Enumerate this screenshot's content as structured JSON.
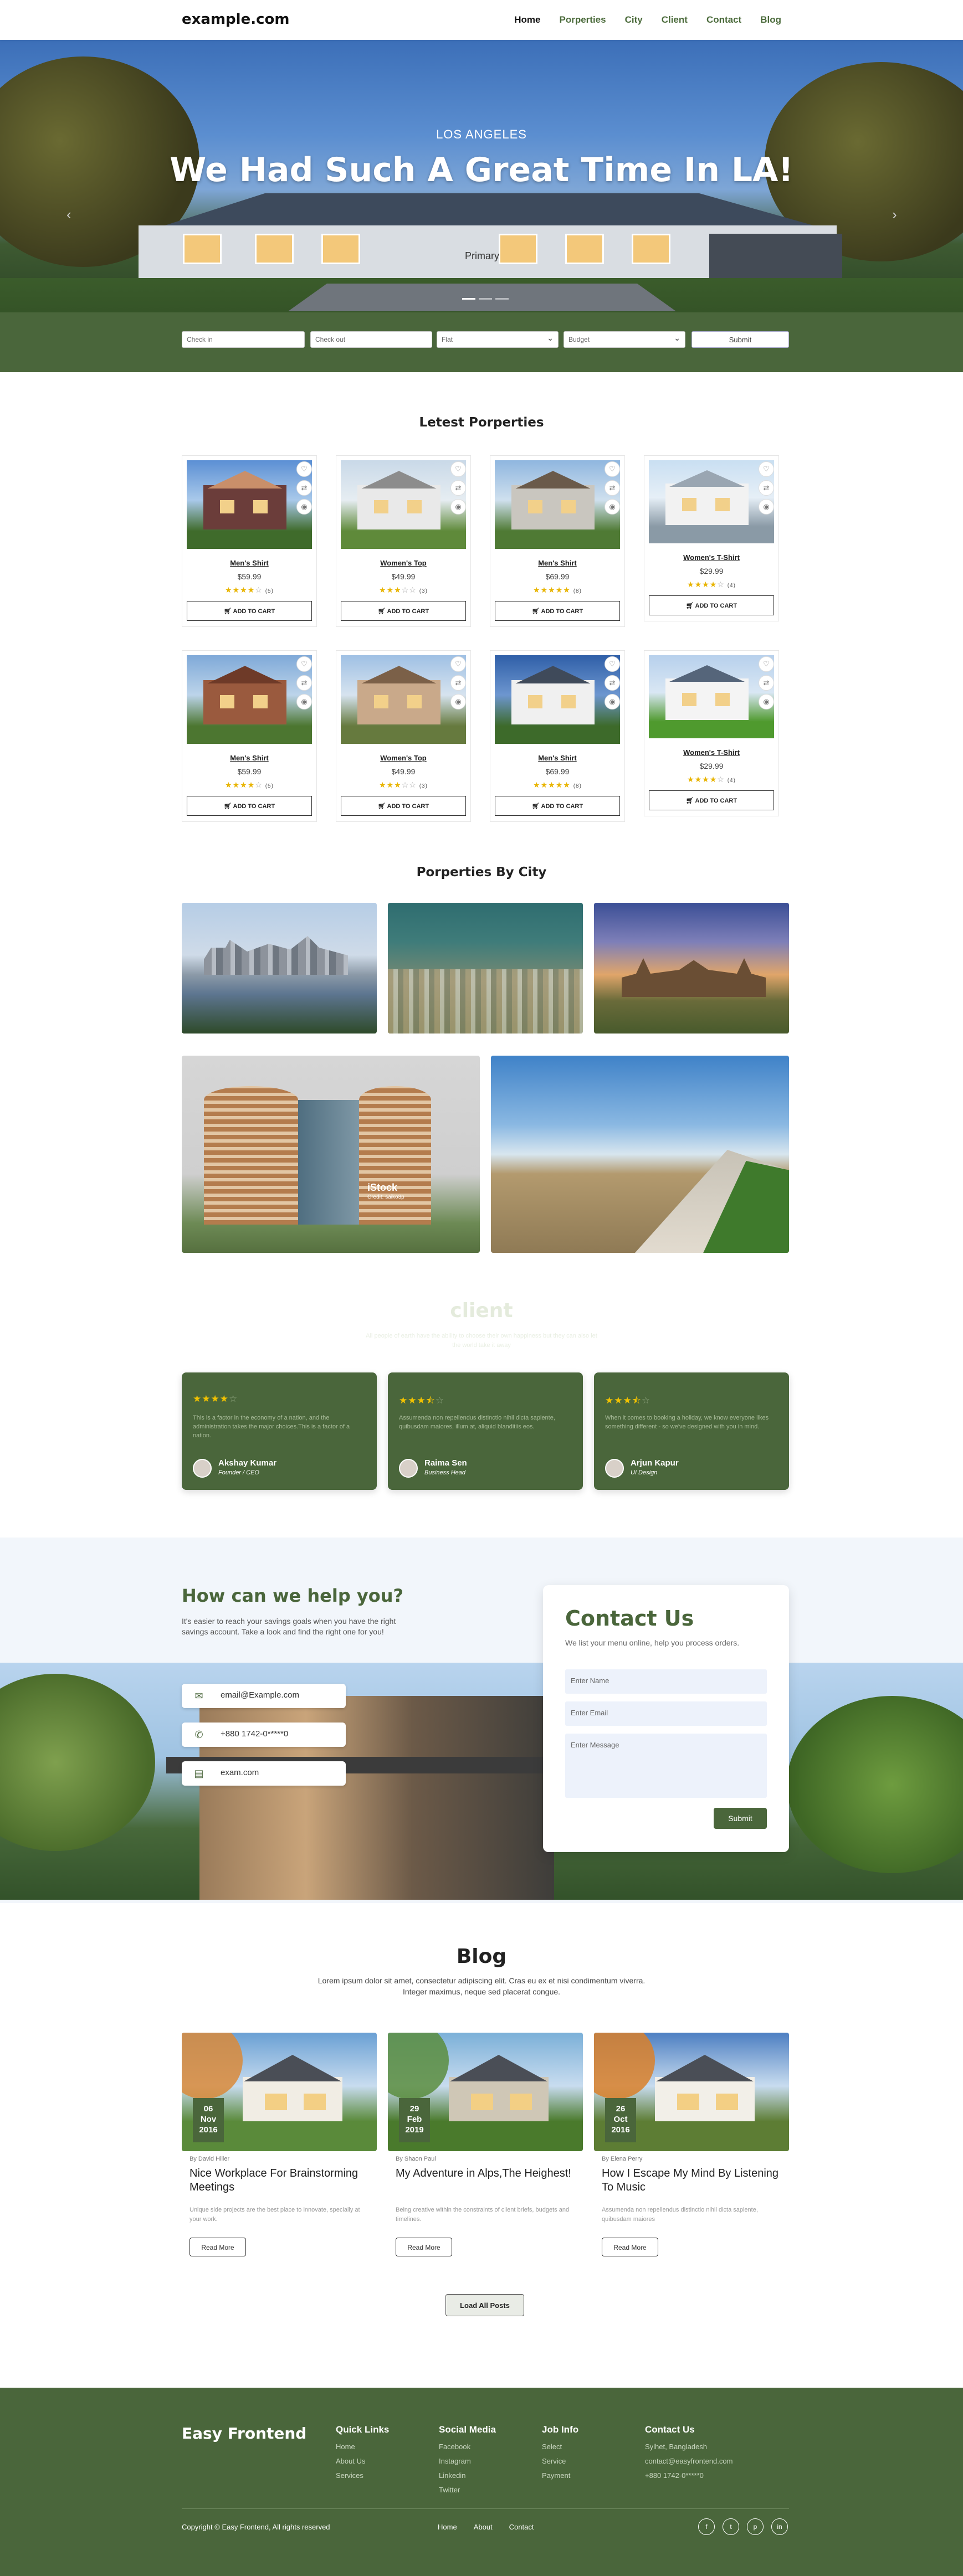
{
  "nav": {
    "brand": "example.com",
    "items": [
      "Home",
      "Porperties",
      "City",
      "Client",
      "Contact",
      "Blog"
    ]
  },
  "hero": {
    "location": "LOS ANGELES",
    "title": "We Had Such A Great Time In LA!",
    "button": "Primary"
  },
  "search": {
    "checkin_placeholder": "Check in",
    "checkout_placeholder": "Check out",
    "type_selected": "Flat",
    "budget_selected": "Budget",
    "submit": "Submit"
  },
  "latest": {
    "title": "Letest Porperties",
    "cart_label": "ADD TO CART",
    "items": [
      {
        "name": "Men's Shirt",
        "price": "$59.99",
        "rating": 4,
        "count": "(5)",
        "scene": "a"
      },
      {
        "name": "Women's Top",
        "price": "$49.99",
        "rating": 3,
        "count": "(3)",
        "scene": "b"
      },
      {
        "name": "Men's Shirt",
        "price": "$69.99",
        "rating": 5,
        "count": "(8)",
        "scene": "c"
      },
      {
        "name": "Women's T-Shirt",
        "price": "$29.99",
        "rating": 4,
        "count": "(4)",
        "scene": "d"
      },
      {
        "name": "Men's Shirt",
        "price": "$59.99",
        "rating": 4,
        "count": "(5)",
        "scene": "e"
      },
      {
        "name": "Women's Top",
        "price": "$49.99",
        "rating": 3,
        "count": "(3)",
        "scene": "f"
      },
      {
        "name": "Men's Shirt",
        "price": "$69.99",
        "rating": 5,
        "count": "(8)",
        "scene": "g"
      },
      {
        "name": "Women's T-Shirt",
        "price": "$29.99",
        "rating": 4,
        "count": "(4)",
        "scene": "h"
      }
    ]
  },
  "city": {
    "title": "Porperties By City",
    "watermark": "iStock",
    "watermark_sub": "Credit: saiko3p"
  },
  "client": {
    "title": "client",
    "subtitle": "All people of earth have the ability to choose their own happiness but they can also let the world take it away",
    "testimonials": [
      {
        "rating": 4,
        "text": "This is a factor in the economy of a nation, and the administration takes the major choices.This is a factor of a nation.",
        "name": "Akshay Kumar",
        "role": "Founder / CEO"
      },
      {
        "rating": 3.5,
        "text": "Assumenda non repellendus distinctio nihil dicta sapiente, quibusdam maiores, illum at, aliquid blanditiis eos.",
        "name": "Raima Sen",
        "role": "Business Head"
      },
      {
        "rating": 3.5,
        "text": "When it comes to booking a holiday, we know everyone likes something different - so we've designed with you in mind.",
        "name": "Arjun Kapur",
        "role": "UI Design"
      }
    ]
  },
  "help": {
    "title": "How can we help you?",
    "text": "It's easier to reach your savings goals when you have the right savings account. Take a look and find the right one for you!",
    "email": "email@Example.com",
    "phone": "+880 1742-0*****0",
    "site": "exam.com"
  },
  "contact": {
    "title": "Contact Us",
    "subtitle": "We list your menu online, help you process orders.",
    "name_placeholder": "Enter Name",
    "email_placeholder": "Enter Email",
    "message_placeholder": "Enter Message",
    "submit": "Submit"
  },
  "blog": {
    "title": "Blog",
    "subtitle": "Lorem ipsum dolor sit amet, consectetur adipiscing elit. Cras eu ex et nisi condimentum viverra. Integer maximus, neque sed placerat congue.",
    "read_more": "Read More",
    "load_all": "Load All Posts",
    "posts": [
      {
        "day": "06",
        "month": "Nov",
        "year": "2016",
        "author": "By David Hiller",
        "title": "Nice Workplace For Brainstorming Meetings",
        "excerpt": "Unique side projects are the best place to innovate, specially at your work."
      },
      {
        "day": "29",
        "month": "Feb",
        "year": "2019",
        "author": "By Shaon Paul",
        "title": "My Adventure in Alps,The Heighest!",
        "excerpt": "Being creative within the constraints of client briefs, budgets and timelines."
      },
      {
        "day": "26",
        "month": "Oct",
        "year": "2016",
        "author": "By Elena Perry",
        "title": "How I Escape My Mind By Listening To Music",
        "excerpt": "Assumenda non repellendus distinctio nihil dicta sapiente, quibusdam maiores"
      }
    ]
  },
  "footer": {
    "brand": "Easy Frontend",
    "cols": [
      {
        "title": "Quick Links",
        "items": [
          "Home",
          "About Us",
          "Services"
        ]
      },
      {
        "title": "Social Media",
        "items": [
          "Facebook",
          "Instagram",
          "Linkedin",
          "Twitter"
        ]
      },
      {
        "title": "Job Info",
        "items": [
          "Select",
          "Service",
          "Payment"
        ]
      },
      {
        "title": "Contact Us",
        "items": [
          "Sylhet, Bangladesh",
          "contact@easyfrontend.com",
          "+880 1742-0*****0"
        ]
      }
    ],
    "copyright": "Copyright © Easy Frontend, All rights reserved",
    "links": [
      "Home",
      "About",
      "Contact"
    ],
    "social_icons": [
      "facebook-icon",
      "twitter-icon",
      "pinterest-icon",
      "linkedin-icon"
    ]
  },
  "colors": {
    "brand_green": "#4a663b",
    "star": "#e8b400"
  }
}
